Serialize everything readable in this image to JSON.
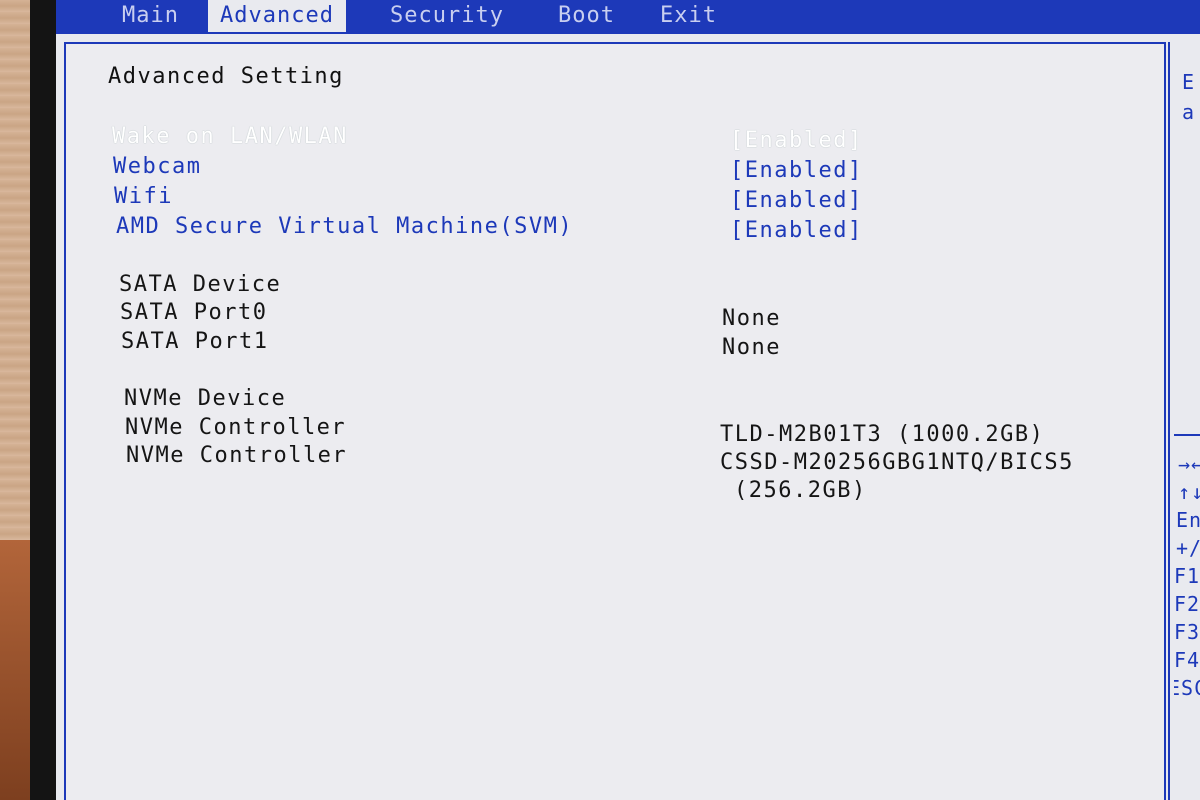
{
  "menu": {
    "tabs": [
      {
        "label": "Main"
      },
      {
        "label": "Advanced"
      },
      {
        "label": "Security"
      },
      {
        "label": "Boot"
      },
      {
        "label": "Exit"
      }
    ],
    "active_index": 1
  },
  "page_title": "Advanced Setting",
  "settings": [
    {
      "label": "Wake on LAN/WLAN",
      "value": "[Enabled]"
    },
    {
      "label": "Webcam",
      "value": "[Enabled]"
    },
    {
      "label": "Wifi",
      "value": "[Enabled]"
    },
    {
      "label": "AMD Secure Virtual Machine(SVM)",
      "value": "[Enabled]"
    }
  ],
  "sata": {
    "header": "SATA Device",
    "ports": [
      {
        "label": "SATA Port0",
        "value": "None"
      },
      {
        "label": "SATA Port1",
        "value": "None"
      }
    ]
  },
  "nvme": {
    "header": "NVMe Device",
    "controllers": [
      {
        "label": "NVMe Controller",
        "value": "TLD-M2B01T3 (1000.2GB)",
        "value2": ""
      },
      {
        "label": "NVMe Controller",
        "value": "CSSD-M20256GBG1NTQ/BICS5",
        "value2": "(256.2GB)"
      }
    ]
  },
  "help": {
    "line1": "E",
    "line2": "a"
  },
  "hotkeys": [
    "→←:",
    "↑↓:",
    "Ent",
    "+/-",
    "F1:",
    "F2:",
    "F3:",
    "F4:",
    "ESC:"
  ],
  "colors": {
    "accent": "#1d39b9",
    "background": "#e9eaef",
    "selected_text": "#ffffff"
  }
}
